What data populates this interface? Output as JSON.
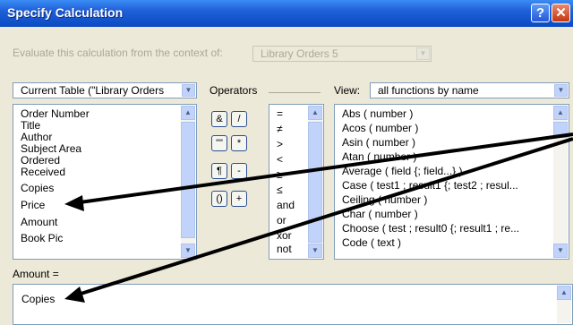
{
  "window": {
    "title": "Specify Calculation"
  },
  "context": {
    "label": "Evaluate this calculation from the context of:",
    "value": "Library Orders 5"
  },
  "table_select": {
    "value": "Current Table (\"Library Orders"
  },
  "fields": [
    "Order Number",
    "Title",
    "Author",
    "Subject Area",
    "Ordered",
    "Received",
    "Copies",
    "Price",
    "Amount",
    "Book Pic"
  ],
  "operators_label": "Operators",
  "operator_buttons": [
    "&",
    "/",
    "\"\"",
    "*",
    "¶",
    "-",
    "()",
    "+"
  ],
  "comparison_ops": [
    "=",
    "≠",
    ">",
    "<",
    "≥",
    "≤",
    "and",
    "or",
    "xor",
    "not"
  ],
  "view": {
    "label": "View:",
    "value": "all functions by name"
  },
  "functions": [
    "Abs ( number )",
    "Acos ( number )",
    "Asin ( number )",
    "Atan ( number )",
    "Average ( field {; field...} )",
    "Case ( test1 ; result1 {; test2 ; resul...",
    "Ceiling ( number )",
    "Char ( number )",
    "Choose ( test ; result0 {; result1 ; re...",
    "Code ( text )"
  ],
  "calc": {
    "label": "Amount =",
    "value": "Copies"
  },
  "arrow_color": "#000000",
  "icons": {
    "help": "help-icon",
    "close": "close-icon",
    "dropdown": "chevron-down-icon"
  }
}
